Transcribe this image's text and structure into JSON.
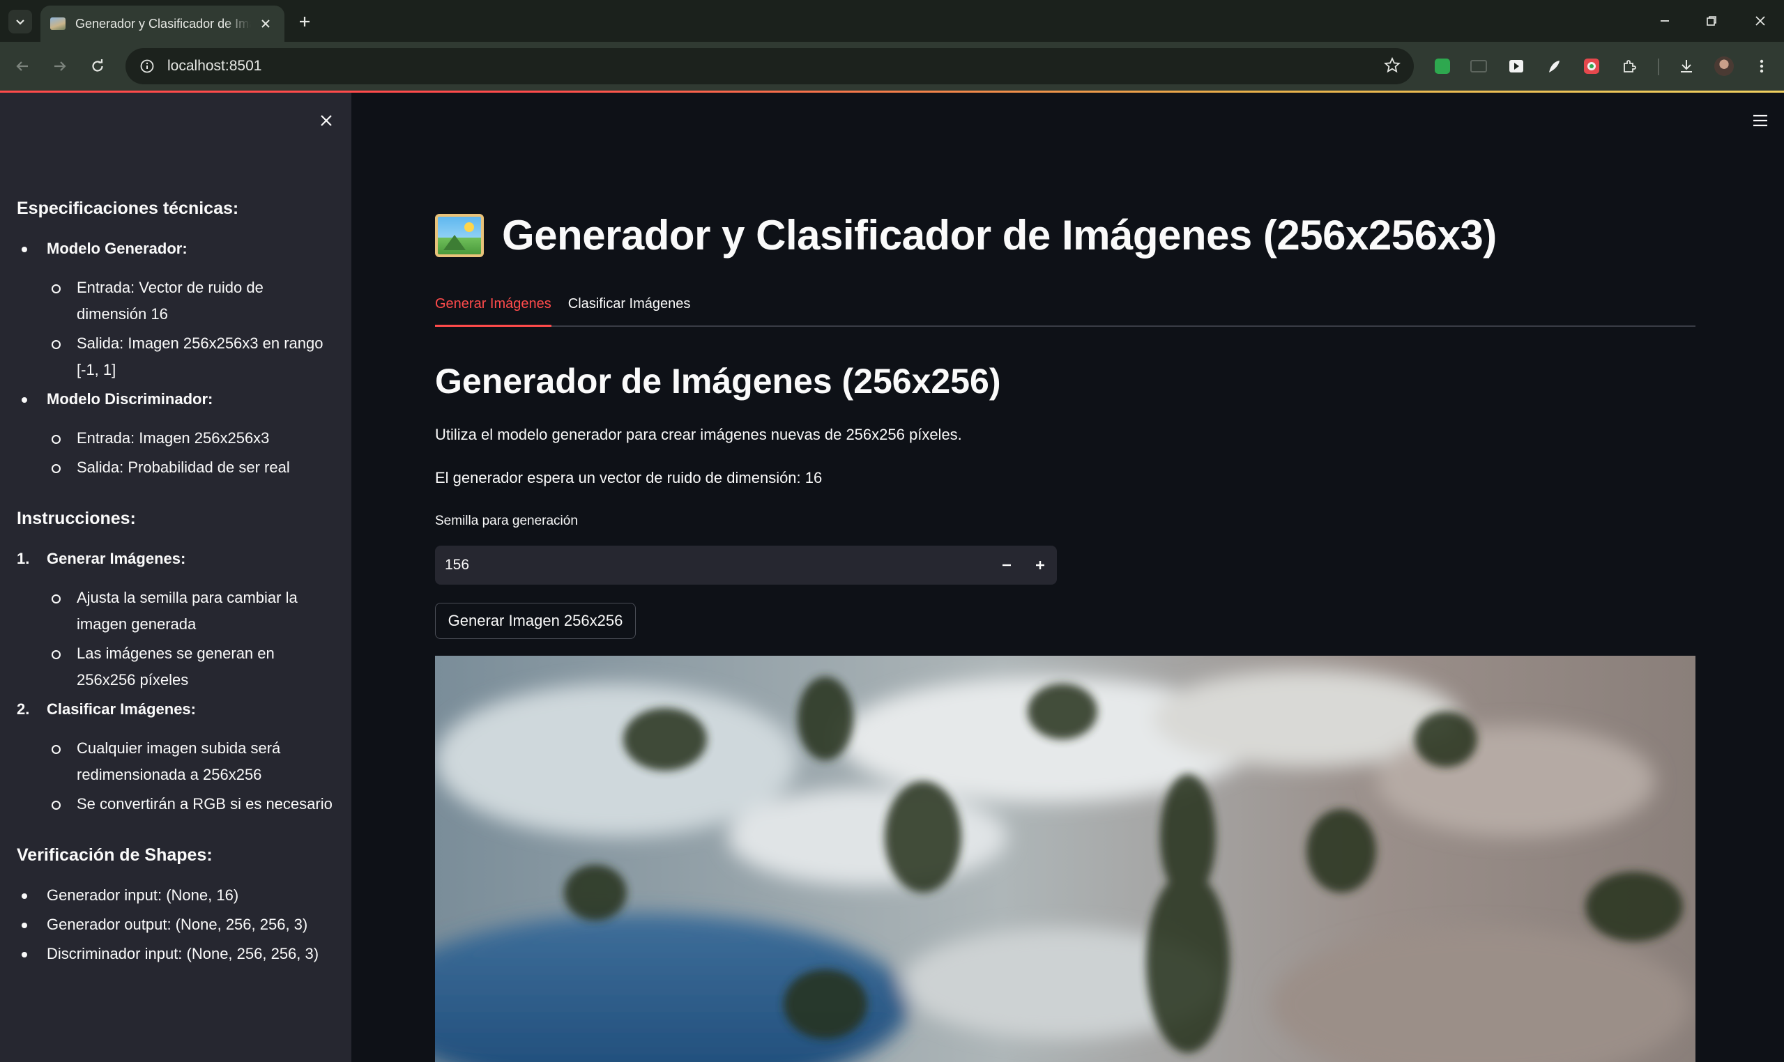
{
  "browser": {
    "tab_title": "Generador y Clasificador de Imágenes (256x256x3)",
    "url": "localhost:8501"
  },
  "sidebar": {
    "sections": [
      {
        "heading": "Especificaciones técnicas:",
        "ordered": false,
        "items": [
          {
            "label": "Modelo Generador:",
            "subitems": [
              "Entrada: Vector de ruido de dimensión 16",
              "Salida: Imagen 256x256x3 en rango [-1, 1]"
            ]
          },
          {
            "label": "Modelo Discriminador:",
            "subitems": [
              "Entrada: Imagen 256x256x3",
              "Salida: Probabilidad de ser real"
            ]
          }
        ]
      },
      {
        "heading": "Instrucciones:",
        "ordered": true,
        "items": [
          {
            "label": "Generar Imágenes:",
            "subitems": [
              "Ajusta la semilla para cambiar la imagen generada",
              "Las imágenes se generan en 256x256 píxeles"
            ]
          },
          {
            "label": "Clasificar Imágenes:",
            "subitems": [
              "Cualquier imagen subida será redimensionada a 256x256",
              "Se convertirán a RGB si es necesario"
            ]
          }
        ]
      },
      {
        "heading": "Verificación de Shapes:",
        "ordered": false,
        "items": [
          {
            "label": "Generador input: (None, 16)",
            "plain": true
          },
          {
            "label": "Generador output: (None, 256, 256, 3)",
            "plain": true
          },
          {
            "label": "Discriminador input: (None, 256, 256, 3)",
            "plain": true
          }
        ]
      }
    ]
  },
  "main": {
    "title": "Generador y Clasificador de Imágenes (256x256x3)",
    "tabs": [
      {
        "label": "Generar Imágenes",
        "active": true
      },
      {
        "label": "Clasificar Imágenes",
        "active": false
      }
    ],
    "section_title": "Generador de Imágenes (256x256)",
    "description": "Utiliza el modelo generador para crear imágenes nuevas de 256x256 píxeles.",
    "noise_info": "El generador espera un vector de ruido de dimensión: 16",
    "seed_label": "Semilla para generación",
    "seed_value": "156",
    "generate_button": "Generar Imagen 256x256"
  },
  "colors": {
    "accent": "#ff4b4b",
    "sidebar_bg": "#262730",
    "main_bg": "#0e1117"
  }
}
